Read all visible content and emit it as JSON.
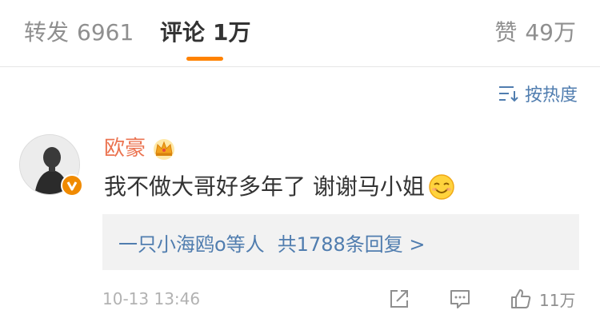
{
  "tabs": {
    "repost": {
      "label": "转发",
      "count": "6961"
    },
    "comment": {
      "label": "评论",
      "count": "1万"
    },
    "like": {
      "label": "赞",
      "count": "49万"
    }
  },
  "sort": {
    "label": "按热度",
    "icon": "sort-icon"
  },
  "comment": {
    "author": "欧豪",
    "badge_icon": "crown-icon",
    "verified_icon": "verified-badge-icon",
    "text": "我不做大哥好多年了 谢谢马小姐",
    "emoji": "smiley-emoji",
    "replies": {
      "people": "一只小海鸥o等人",
      "summary": "共1788条回复 >"
    },
    "time": "10-13 13:46",
    "likes": "11万"
  },
  "colors": {
    "accent": "#ff8200",
    "link": "#507daf",
    "author": "#eb7350",
    "muted": "#b2b2b2"
  }
}
